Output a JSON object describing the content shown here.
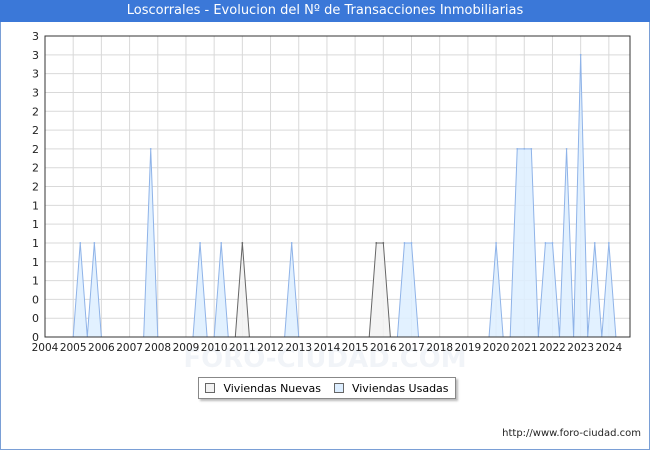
{
  "title": "Loscorrales - Evolucion del Nº de Transacciones Inmobiliarias",
  "footer": "http://www.foro-ciudad.com",
  "watermark": "FORO-CIUDAD.COM",
  "colors": {
    "title_bg": "#3b78d8",
    "grid": "#d9d9d9",
    "nuevas_fill": "#f2f2f2",
    "nuevas_line": "#666666",
    "usadas_fill": "#ddeeff",
    "usadas_line": "#8fb3e8"
  },
  "chart_data": {
    "type": "area",
    "x_unit": "year",
    "xlim": [
      2004,
      2024.75
    ],
    "ylim": [
      0,
      3.2
    ],
    "grid": true,
    "legend_position": "bottom-center",
    "x_ticks": [
      "2004",
      "2005",
      "2006",
      "2007",
      "2008",
      "2009",
      "2010",
      "2011",
      "2012",
      "2013",
      "2014",
      "2015",
      "2016",
      "2017",
      "2018",
      "2019",
      "2020",
      "2021",
      "2022",
      "2023",
      "2024"
    ],
    "y_ticks": [
      {
        "value": 0,
        "label": "0"
      },
      {
        "value": 0.2,
        "label": "0"
      },
      {
        "value": 0.4,
        "label": "0"
      },
      {
        "value": 0.6,
        "label": "1"
      },
      {
        "value": 0.8,
        "label": "1"
      },
      {
        "value": 1.0,
        "label": "1"
      },
      {
        "value": 1.2,
        "label": "1"
      },
      {
        "value": 1.4,
        "label": "1"
      },
      {
        "value": 1.6,
        "label": "2"
      },
      {
        "value": 1.8,
        "label": "2"
      },
      {
        "value": 2.0,
        "label": "2"
      },
      {
        "value": 2.2,
        "label": "2"
      },
      {
        "value": 2.4,
        "label": "2"
      },
      {
        "value": 2.6,
        "label": "3"
      },
      {
        "value": 2.8,
        "label": "3"
      },
      {
        "value": 3.0,
        "label": "3"
      },
      {
        "value": 3.2,
        "label": "3"
      }
    ],
    "series": [
      {
        "name": "Viviendas Nuevas",
        "points": [
          [
            2004.0,
            0
          ],
          [
            2010.75,
            0
          ],
          [
            2011.0,
            1
          ],
          [
            2011.25,
            0
          ],
          [
            2015.5,
            0
          ],
          [
            2015.75,
            1
          ],
          [
            2016.0,
            1
          ],
          [
            2016.25,
            0
          ],
          [
            2024.75,
            0
          ]
        ]
      },
      {
        "name": "Viviendas Usadas",
        "points": [
          [
            2004.0,
            0
          ],
          [
            2005.0,
            0
          ],
          [
            2005.25,
            1
          ],
          [
            2005.5,
            0
          ],
          [
            2005.75,
            1
          ],
          [
            2006.0,
            0
          ],
          [
            2007.5,
            0
          ],
          [
            2007.75,
            2
          ],
          [
            2008.0,
            0
          ],
          [
            2009.25,
            0
          ],
          [
            2009.5,
            1
          ],
          [
            2009.75,
            0
          ],
          [
            2010.0,
            0
          ],
          [
            2010.25,
            1
          ],
          [
            2010.5,
            0
          ],
          [
            2012.5,
            0
          ],
          [
            2012.75,
            1
          ],
          [
            2013.0,
            0
          ],
          [
            2016.5,
            0
          ],
          [
            2016.75,
            1
          ],
          [
            2017.0,
            1
          ],
          [
            2017.25,
            0
          ],
          [
            2019.75,
            0
          ],
          [
            2020.0,
            1
          ],
          [
            2020.25,
            0
          ],
          [
            2020.5,
            0
          ],
          [
            2020.75,
            2
          ],
          [
            2021.0,
            2
          ],
          [
            2021.25,
            2
          ],
          [
            2021.5,
            0
          ],
          [
            2021.75,
            1
          ],
          [
            2022.0,
            1
          ],
          [
            2022.25,
            0
          ],
          [
            2022.5,
            2
          ],
          [
            2022.75,
            0
          ],
          [
            2023.0,
            3
          ],
          [
            2023.25,
            0
          ],
          [
            2023.5,
            1
          ],
          [
            2023.75,
            0
          ],
          [
            2024.0,
            1
          ],
          [
            2024.25,
            0
          ],
          [
            2024.75,
            0
          ]
        ]
      }
    ]
  },
  "legend": {
    "items": [
      {
        "label": "Viviendas Nuevas"
      },
      {
        "label": "Viviendas Usadas"
      }
    ]
  }
}
